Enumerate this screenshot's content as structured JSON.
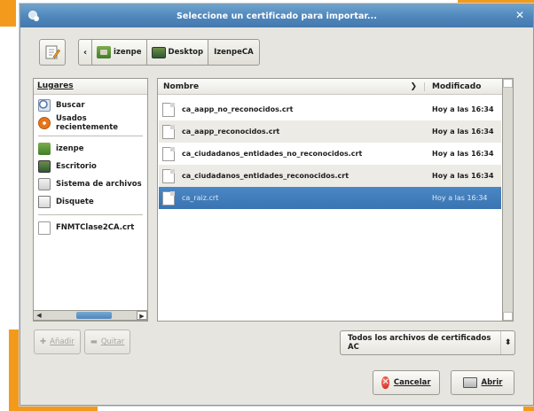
{
  "window": {
    "title": "Seleccione un certificado para importar..."
  },
  "pathbar": {
    "crumbs": [
      "izenpe",
      "Desktop",
      "IzenpeCA"
    ]
  },
  "places": {
    "header": "Lugares",
    "items": [
      {
        "label": "Buscar",
        "icon": "search-icon"
      },
      {
        "label": "Usados recientemente",
        "icon": "recent-icon"
      },
      {
        "label": "izenpe",
        "icon": "home-folder-icon"
      },
      {
        "label": "Escritorio",
        "icon": "desktop-icon"
      },
      {
        "label": "Sistema de archivos",
        "icon": "filesystem-icon"
      },
      {
        "label": "Disquete",
        "icon": "floppy-icon"
      },
      {
        "label": "FNMTClase2CA.crt",
        "icon": "file-icon"
      }
    ],
    "add_label": "Añadir",
    "remove_label": "Quitar"
  },
  "files": {
    "col_name": "Nombre",
    "col_modified": "Modificado",
    "rows": [
      {
        "name": "ca_aapp_no_reconocidos.crt",
        "modified": "Hoy a las 16:34"
      },
      {
        "name": "ca_aapp_reconocidos.crt",
        "modified": "Hoy a las 16:34"
      },
      {
        "name": "ca_ciudadanos_entidades_no_reconocidos.crt",
        "modified": "Hoy a las 16:34"
      },
      {
        "name": "ca_ciudadanos_entidades_reconocidos.crt",
        "modified": "Hoy a las 16:34"
      },
      {
        "name": "ca_raiz.crt",
        "modified": "Hoy a las 16:34",
        "selected": true
      }
    ]
  },
  "filter": {
    "selected": "Todos los archivos de certificados AC"
  },
  "actions": {
    "cancel_label": "Cancelar",
    "open_label": "Abrir"
  },
  "colors": {
    "titlebar": "#4f86bb",
    "selection": "#3a74b2",
    "accent_orange": "#f39a1c"
  }
}
